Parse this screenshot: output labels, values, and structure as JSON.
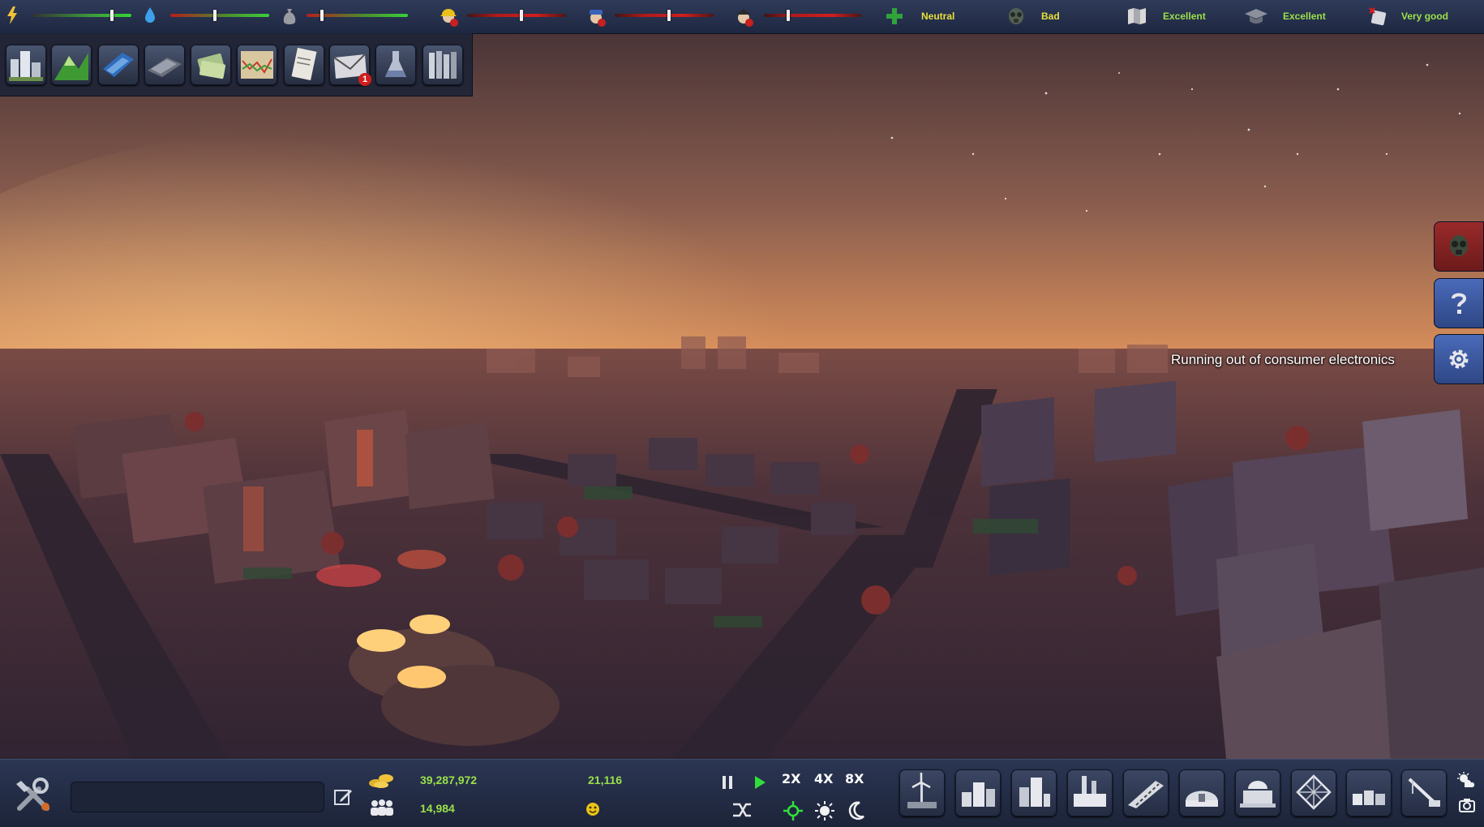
{
  "top_bar": {
    "meters": [
      {
        "icon": "lightning-icon",
        "level": 0.8
      },
      {
        "icon": "water-drop-icon",
        "level": 0.45
      },
      {
        "icon": "waste-bag-icon",
        "level": 0.15
      },
      {
        "icon": "worker-helmet-icon",
        "level": 0.55
      },
      {
        "icon": "police-officer-icon",
        "level": 0.55
      },
      {
        "icon": "firefighter-icon",
        "level": 0.25
      }
    ],
    "statuses": [
      {
        "icon": "health-cross-icon",
        "text": "Neutral",
        "color": "#e7e03c"
      },
      {
        "icon": "gas-mask-icon",
        "text": "Bad",
        "color": "#e7e03c"
      },
      {
        "icon": "map-icon",
        "text": "Excellent",
        "color": "#9be04a"
      },
      {
        "icon": "graduation-cap-icon",
        "text": "Excellent",
        "color": "#9be04a"
      },
      {
        "icon": "lottery-ticket-icon",
        "text": "Very good",
        "color": "#9be04a"
      }
    ]
  },
  "advisor_panel": {
    "items": [
      {
        "icon": "city-overview-icon"
      },
      {
        "icon": "landscape-icon"
      },
      {
        "icon": "transport-icon"
      },
      {
        "icon": "industry-icon"
      },
      {
        "icon": "money-icon"
      },
      {
        "icon": "economy-chart-icon"
      },
      {
        "icon": "documents-icon"
      },
      {
        "icon": "mail-icon",
        "badge": "1"
      },
      {
        "icon": "research-flask-icon"
      },
      {
        "icon": "library-icon"
      }
    ]
  },
  "side_buttons": [
    {
      "icon": "pollution-mask-icon",
      "color": "#8a2323"
    },
    {
      "icon": "help-icon",
      "color": "#3a5aa6"
    },
    {
      "icon": "settings-gear-icon",
      "color": "#3a5aa6"
    }
  ],
  "notification": "Running out of consumer electronics",
  "bottom_bar": {
    "city_name": "",
    "money": "39,287,972",
    "population": "14,984",
    "happiness_value": "21,116",
    "speed_labels": {
      "x2": "2X",
      "x4": "4X",
      "x8": "8X"
    },
    "build_tools": [
      "wind-power-icon",
      "residential-icon",
      "commercial-icon",
      "industrial-icon",
      "road-icon",
      "services-icon",
      "government-building-icon",
      "greenhouse-icon",
      "storage-icon",
      "crane-icon"
    ]
  },
  "colors": {
    "accent_green": "#9be04a",
    "accent_yellow": "#e7e03c",
    "bar_bg": "#1e2740"
  }
}
